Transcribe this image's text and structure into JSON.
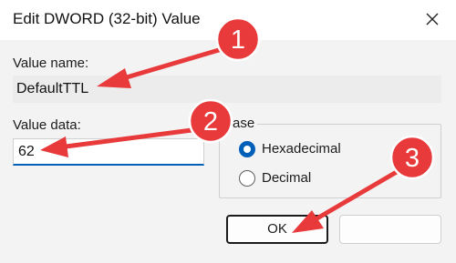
{
  "dialog": {
    "title": "Edit DWORD (32-bit) Value",
    "value_name_label": "Value name:",
    "value_name": "DefaultTTL",
    "value_data_label": "Value data:",
    "value_data": "62",
    "base_group_label": "ase",
    "base_options": [
      {
        "label": "Hexadecimal",
        "selected": true
      },
      {
        "label": "Decimal",
        "selected": false
      }
    ],
    "ok_label": "OK"
  },
  "annotations": {
    "color": "#e8393b",
    "markers": [
      "1",
      "2",
      "3"
    ]
  },
  "icons": {
    "close": "close-icon"
  }
}
